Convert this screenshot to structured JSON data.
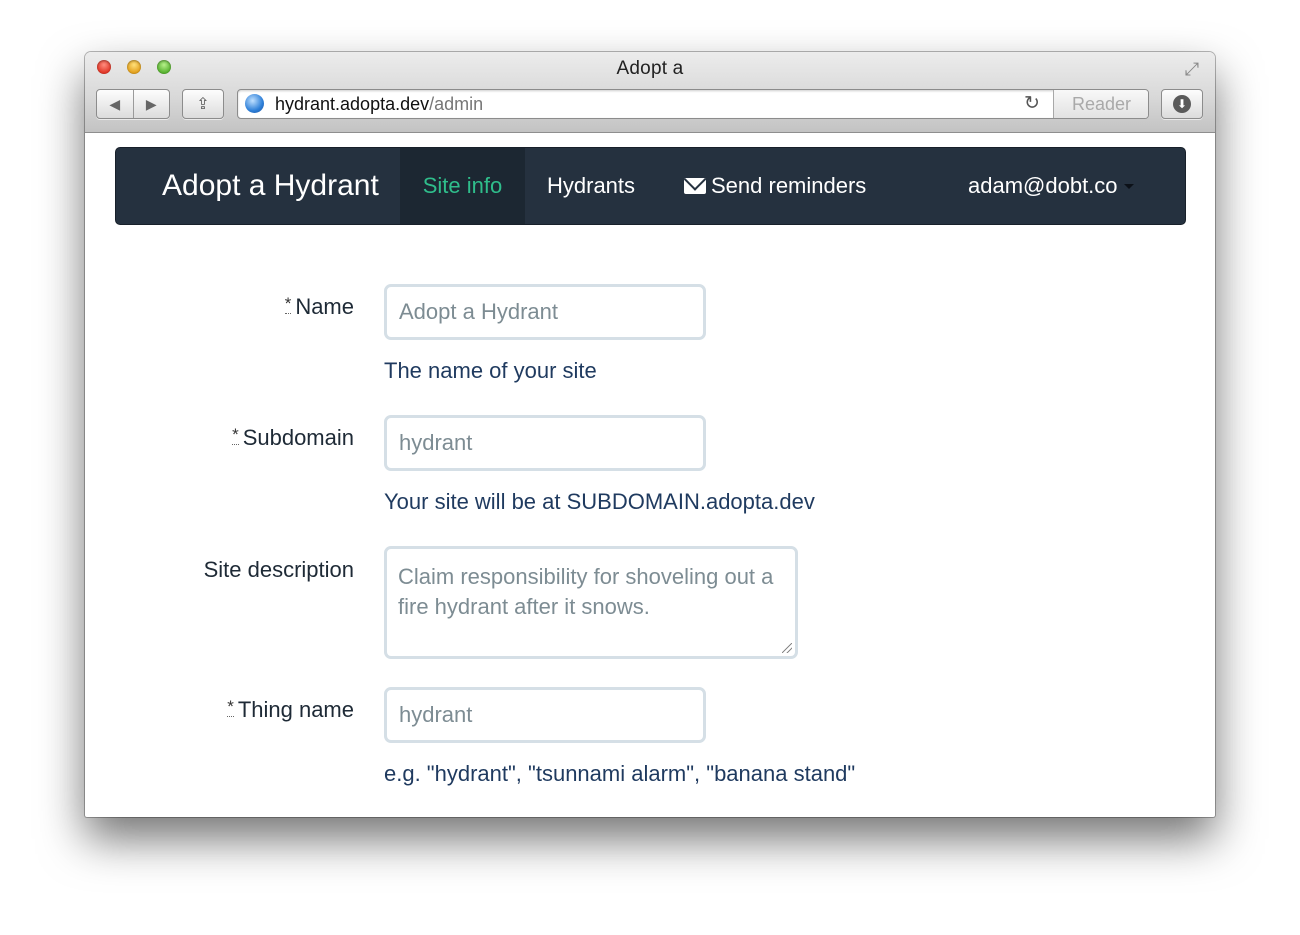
{
  "browser": {
    "window_title": "Adopt a",
    "url_host": "hydrant.adopta.dev",
    "url_path": "/admin",
    "reader_label": "Reader",
    "back_glyph": "◀",
    "forward_glyph": "▶",
    "reload_glyph": "↻",
    "fullscreen_glyph": "⤢",
    "download_glyph": "⬇",
    "share_glyph": "⇪"
  },
  "navbar": {
    "brand": "Adopt a Hydrant",
    "items": [
      {
        "label": "Site info",
        "active": true
      },
      {
        "label": "Hydrants",
        "active": false
      },
      {
        "label": "Send reminders",
        "icon": "envelope-icon",
        "active": false
      }
    ],
    "user_menu": "adam@dobt.co"
  },
  "form": {
    "required_marker": "*",
    "fields": [
      {
        "label": "Name",
        "required": true,
        "placeholder": "Adopt a Hydrant",
        "help": "The name of your site"
      },
      {
        "label": "Subdomain",
        "required": true,
        "placeholder": "hydrant",
        "help": "Your site will be at SUBDOMAIN.adopta.dev"
      },
      {
        "label": "Site description",
        "required": false,
        "placeholder": "Claim responsibility for shoveling out a fire hydrant after it snows.",
        "help": ""
      },
      {
        "label": "Thing name",
        "required": true,
        "placeholder": "hydrant",
        "help": "e.g. \"hydrant\", \"tsunnami alarm\", \"banana stand\""
      }
    ]
  },
  "colors": {
    "navbar_bg": "#25313f",
    "active_link": "#2fbd8b",
    "help_text": "#1f3a5f",
    "input_border": "#d5dfe6"
  }
}
